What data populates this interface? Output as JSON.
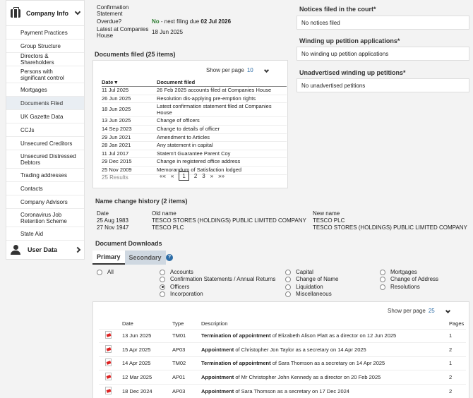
{
  "sidebar": {
    "header": "Company Info",
    "items": [
      "Payment Practices",
      "Group Structure",
      "Directors & Shareholders",
      "Persons with significant control",
      "Mortgages",
      "Documents Filed",
      "UK Gazette Data",
      "CCJs",
      "Unsecured Creditors",
      "Unsecured Distressed Debtors",
      "Trading addresses",
      "Contacts",
      "Company Advisors",
      "Coronavirus Job Retention Scheme",
      "State Aid"
    ],
    "active": "Documents Filed",
    "user_data": "User Data"
  },
  "confirmation": {
    "label": "Confirmation Statement",
    "overdue_label": "Overdue?",
    "overdue_value": "No",
    "overdue_suffix": " - next filing due ",
    "overdue_date": "02 Jul 2026",
    "latest_label": "Latest at Companies House",
    "latest_value": "18 Jun 2025"
  },
  "documents_filed": {
    "title": "Documents filed (25 items)",
    "show_per_page_label": "Show per page",
    "show_per_page_value": "10",
    "col_date": "Date",
    "col_doc": "Document filed",
    "rows": [
      {
        "date": "11 Jul 2025",
        "doc": "26 Feb 2025 accounts filed at Companies House"
      },
      {
        "date": "26 Jun 2025",
        "doc": "Resolution dis-applying pre-emption rights"
      },
      {
        "date": "18 Jun 2025",
        "doc": "Latest confirmation statement filed at Companies House"
      },
      {
        "date": "13 Jun 2025",
        "doc": "Change of officers"
      },
      {
        "date": "14 Sep 2023",
        "doc": "Change to details of officer"
      },
      {
        "date": "29 Jun 2021",
        "doc": "Amendment to Articles"
      },
      {
        "date": "28 Jan 2021",
        "doc": "Any statement in capital"
      },
      {
        "date": "11 Jul 2017",
        "doc": "Statem't Guarantee Parent Coy"
      },
      {
        "date": "29 Dec 2015",
        "doc": "Change in registered office address"
      },
      {
        "date": "25 Nov 2009",
        "doc": "Memorandum of Satisfaction lodged"
      }
    ],
    "results": "25 Results",
    "pager": {
      "first": "««",
      "prev": "«",
      "pages": [
        "1",
        "2",
        "3"
      ],
      "current": "1",
      "next": "»",
      "last": "»»"
    }
  },
  "right": {
    "notices_title": "Notices filed in the court*",
    "notices_value": "No notices filed",
    "winding_title": "Winding up petition applications*",
    "winding_value": "No winding up petition applications",
    "unadvertised_title": "Unadvertised winding up petitions*",
    "unadvertised_value": "No unadvertised petitions"
  },
  "name_change": {
    "title": "Name change history (2 items)",
    "col_date": "Date",
    "col_old": "Old name",
    "col_new": "New name",
    "rows": [
      {
        "date": "25 Aug 1983",
        "old": "TESCO STORES (HOLDINGS) PUBLIC LIMITED COMPANY",
        "new": "TESCO PLC"
      },
      {
        "date": "27 Nov 1947",
        "old": "TESCO PLC",
        "new": "TESCO STORES (HOLDINGS) PUBLIC LIMITED COMPANY"
      }
    ]
  },
  "downloads": {
    "title": "Document Downloads",
    "tab_primary": "Primary",
    "tab_secondary": "Secondary",
    "help": "?",
    "filters": {
      "all": "All",
      "accounts": "Accounts",
      "confirmation": "Confirmation Statements / Annual Returns",
      "officers": "Officers",
      "incorporation": "Incorporation",
      "capital": "Capital",
      "change_of_name": "Change of Name",
      "liquidation": "Liquidation",
      "miscellaneous": "Miscellaneous",
      "mortgages": "Mortgages",
      "change_of_address": "Change of Address",
      "resolutions": "Resolutions"
    },
    "selected_filter": "Officers",
    "show_per_page_label": "Show per page",
    "show_per_page_value": "25",
    "col_date": "Date",
    "col_type": "Type",
    "col_desc": "Description",
    "col_pages": "Pages",
    "rows": [
      {
        "date": "13 Jun 2025",
        "type": "TM01",
        "bold": "Termination of appointment",
        "rest": " of Elizabeth Alison Platt as a director on 12 Jun 2025",
        "pages": "1"
      },
      {
        "date": "15 Apr 2025",
        "type": "AP03",
        "bold": "Appointment",
        "rest": " of Christopher Jon Taylor as a secretary on 14 Apr 2025",
        "pages": "2"
      },
      {
        "date": "14 Apr 2025",
        "type": "TM02",
        "bold": "Termination of appointment",
        "rest": " of Sara Thomson as a secretary on 14 Apr 2025",
        "pages": "1"
      },
      {
        "date": "12 Mar 2025",
        "type": "AP01",
        "bold": "Appointment",
        "rest": " of Mr Christopher John Kennedy as a director on 20 Feb 2025",
        "pages": "2"
      },
      {
        "date": "18 Dec 2024",
        "type": "AP03",
        "bold": "Appointment",
        "rest": " of Sara Thomson as a secretary on 17 Dec 2024",
        "pages": "2"
      }
    ]
  }
}
